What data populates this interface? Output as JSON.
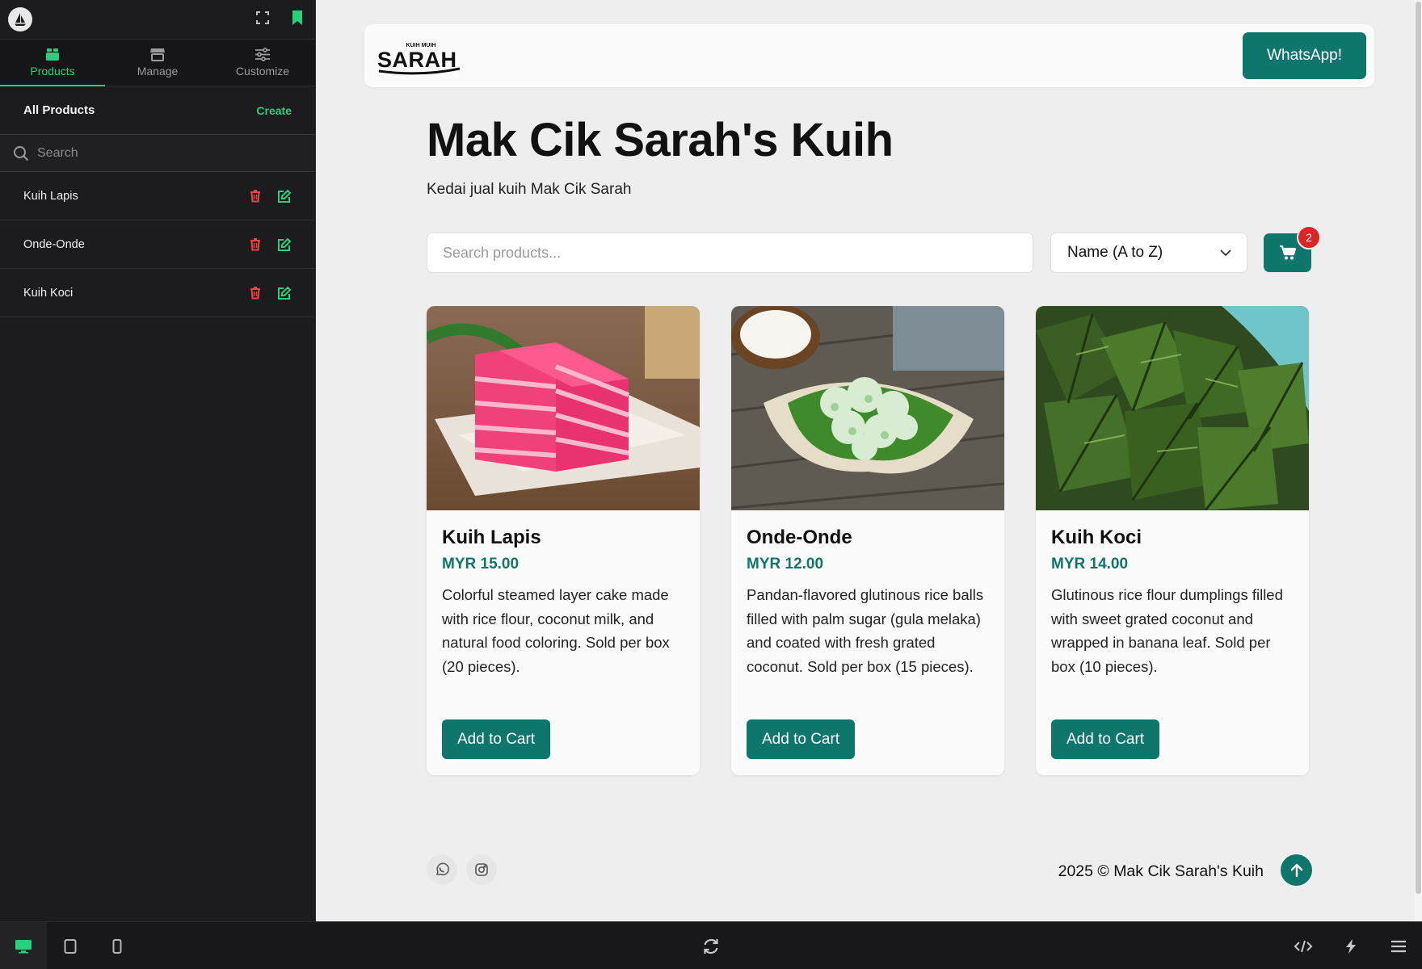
{
  "editor": {
    "tabs": [
      {
        "label": "Products",
        "icon": "box-icon",
        "active": true
      },
      {
        "label": "Manage",
        "icon": "store-icon",
        "active": false
      },
      {
        "label": "Customize",
        "icon": "sliders-icon",
        "active": false
      }
    ],
    "section_title": "All Products",
    "create_label": "Create",
    "search_placeholder": "Search",
    "products": [
      {
        "name": "Kuih Lapis"
      },
      {
        "name": "Onde-Onde"
      },
      {
        "name": "Kuih Koci"
      }
    ]
  },
  "site": {
    "logo_text": "SARAH",
    "logo_small": "KUIH MUIH",
    "whatsapp_label": "WhatsApp!",
    "title": "Mak Cik Sarah's Kuih",
    "subtitle": "Kedai jual kuih Mak Cik Sarah",
    "search_placeholder": "Search products...",
    "sort_value": "Name (A to Z)",
    "cart_count": "2",
    "add_label": "Add to Cart",
    "products": [
      {
        "name": "Kuih Lapis",
        "price": "MYR 15.00",
        "description": "Colorful steamed layer cake made with rice flour, coconut milk, and natural food coloring. Sold per box (20 pieces)."
      },
      {
        "name": "Onde-Onde",
        "price": "MYR 12.00",
        "description": "Pandan-flavored glutinous rice balls filled with palm sugar (gula melaka) and coated with fresh grated coconut. Sold per box (15 pieces)."
      },
      {
        "name": "Kuih Koci",
        "price": "MYR 14.00",
        "description": "Glutinous rice flour dumplings filled with sweet grated coconut and wrapped in banana leaf. Sold per box (10 pieces)."
      }
    ],
    "copyright": "2025 © Mak Cik Sarah's Kuih"
  },
  "colors": {
    "accent": "#27d07a",
    "brand": "#0f766e",
    "danger": "#dc2626",
    "sidebar_bg": "#1c1c1e",
    "page_bg": "#eeeeee"
  }
}
